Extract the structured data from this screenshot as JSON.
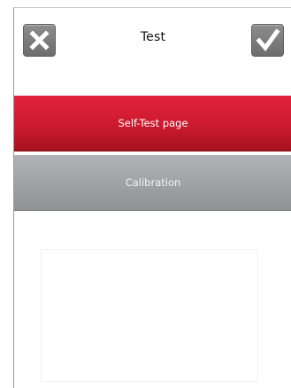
{
  "header": {
    "title": "Test",
    "cancel_icon": "close-icon",
    "confirm_icon": "checkmark-icon"
  },
  "menu": {
    "items": [
      {
        "label": "Self-Test page",
        "color": "#cb1a2e"
      },
      {
        "label": "Calibration",
        "color": "#9fa1a4"
      }
    ]
  }
}
